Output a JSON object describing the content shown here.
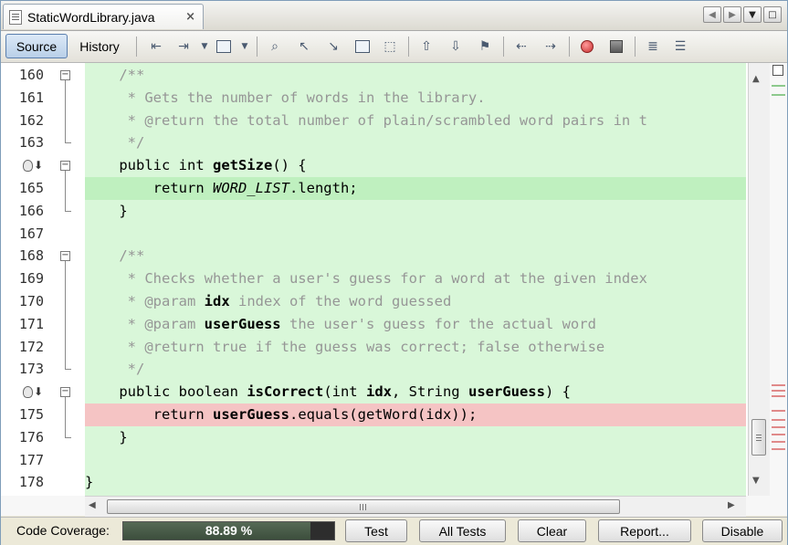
{
  "tab": {
    "title": "StaticWordLibrary.java",
    "close": "×"
  },
  "nav": {
    "prev": "◀",
    "next": "▶",
    "menu": "▼",
    "maximize": "□"
  },
  "toolbar": {
    "source_label": "Source",
    "history_label": "History"
  },
  "editor": {
    "lines": [
      {
        "num": "160",
        "segments": [
          {
            "t": "    /**",
            "c": "cmt"
          }
        ],
        "fold": "open",
        "icon": null,
        "hl": null
      },
      {
        "num": "161",
        "segments": [
          {
            "t": "     * Gets the number of words in the library.",
            "c": "cmt"
          }
        ],
        "fold": null,
        "icon": null,
        "hl": null
      },
      {
        "num": "162",
        "segments": [
          {
            "t": "     * @return the total number of plain/scrambled word pairs in t",
            "c": "cmt"
          }
        ],
        "fold": null,
        "icon": null,
        "hl": null
      },
      {
        "num": "163",
        "segments": [
          {
            "t": "     */",
            "c": "cmt"
          }
        ],
        "fold": "end",
        "icon": null,
        "hl": null
      },
      {
        "num": "",
        "segments": [
          {
            "t": "    public int ",
            "c": "kw"
          },
          {
            "t": "getSize",
            "c": "b"
          },
          {
            "t": "() {",
            "c": "kw"
          }
        ],
        "fold": "open",
        "icon": "override",
        "hl": null
      },
      {
        "num": "165",
        "segments": [
          {
            "t": "        return ",
            "c": "kw"
          },
          {
            "t": "WORD_LIST",
            "c": "it"
          },
          {
            "t": ".length;",
            "c": "kw"
          }
        ],
        "fold": null,
        "icon": null,
        "hl": "green"
      },
      {
        "num": "166",
        "segments": [
          {
            "t": "    }",
            "c": "kw"
          }
        ],
        "fold": "end",
        "icon": null,
        "hl": null
      },
      {
        "num": "167",
        "segments": [
          {
            "t": "",
            "c": "kw"
          }
        ],
        "fold": null,
        "icon": null,
        "hl": null
      },
      {
        "num": "168",
        "segments": [
          {
            "t": "    /**",
            "c": "cmt"
          }
        ],
        "fold": "open",
        "icon": null,
        "hl": null
      },
      {
        "num": "169",
        "segments": [
          {
            "t": "     * Checks whether a user's guess for a word at the given index",
            "c": "cmt"
          }
        ],
        "fold": null,
        "icon": null,
        "hl": null
      },
      {
        "num": "170",
        "segments": [
          {
            "t": "     * @param ",
            "c": "cmt"
          },
          {
            "t": "idx",
            "c": "cmtb"
          },
          {
            "t": " index of the word guessed",
            "c": "cmt"
          }
        ],
        "fold": null,
        "icon": null,
        "hl": null
      },
      {
        "num": "171",
        "segments": [
          {
            "t": "     * @param ",
            "c": "cmt"
          },
          {
            "t": "userGuess",
            "c": "cmtb"
          },
          {
            "t": " the user's guess for the actual word",
            "c": "cmt"
          }
        ],
        "fold": null,
        "icon": null,
        "hl": null
      },
      {
        "num": "172",
        "segments": [
          {
            "t": "     * @return true if the guess was correct; false otherwise",
            "c": "cmt"
          }
        ],
        "fold": null,
        "icon": null,
        "hl": null
      },
      {
        "num": "173",
        "segments": [
          {
            "t": "     */",
            "c": "cmt"
          }
        ],
        "fold": "end",
        "icon": null,
        "hl": null
      },
      {
        "num": "",
        "segments": [
          {
            "t": "    public boolean ",
            "c": "kw"
          },
          {
            "t": "isCorrect",
            "c": "b"
          },
          {
            "t": "(int ",
            "c": "kw"
          },
          {
            "t": "idx",
            "c": "b"
          },
          {
            "t": ", String ",
            "c": "kw"
          },
          {
            "t": "userGuess",
            "c": "b"
          },
          {
            "t": ") {",
            "c": "kw"
          }
        ],
        "fold": "open",
        "icon": "override",
        "hl": null
      },
      {
        "num": "175",
        "segments": [
          {
            "t": "        return ",
            "c": "kw"
          },
          {
            "t": "userGuess",
            "c": "b"
          },
          {
            "t": ".equals(getWord(idx));",
            "c": "kw"
          }
        ],
        "fold": null,
        "icon": null,
        "hl": "red"
      },
      {
        "num": "176",
        "segments": [
          {
            "t": "    }",
            "c": "kw"
          }
        ],
        "fold": "end",
        "icon": null,
        "hl": null
      },
      {
        "num": "177",
        "segments": [
          {
            "t": "",
            "c": "kw"
          }
        ],
        "fold": null,
        "icon": null,
        "hl": null
      },
      {
        "num": "178",
        "segments": [
          {
            "t": "}",
            "c": "kw"
          }
        ],
        "fold": null,
        "icon": null,
        "hl": null
      }
    ]
  },
  "scrollbar": {
    "grip": "III"
  },
  "coverage": {
    "label": "Code Coverage:",
    "value_text": "88.89 %",
    "fraction": 0.8889,
    "buttons": [
      "Test",
      "All Tests",
      "Clear",
      "Report...",
      "Disable"
    ]
  },
  "colors": {
    "covered_bg": "#d9f7d9",
    "covered_line": "#bff0bf",
    "uncovered_line": "#f5c4c4",
    "source_tab_accent": "#b9cfe8"
  },
  "icons": [
    "file-icon",
    "back-icon",
    "forward-icon",
    "search-icon",
    "find-previous-icon",
    "find-next-icon",
    "toggle-highlight-icon",
    "toggle-bookmark-icon",
    "previous-bookmark-icon",
    "next-bookmark-icon",
    "shift-left-icon",
    "shift-right-icon",
    "record-macro-icon",
    "stop-macro-icon",
    "comment-icon",
    "uncomment-icon"
  ]
}
